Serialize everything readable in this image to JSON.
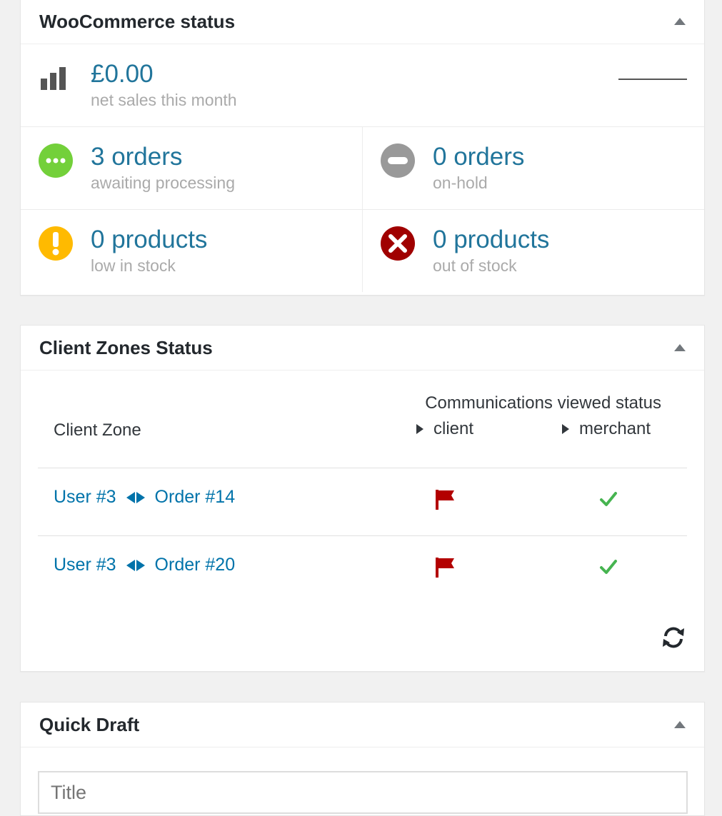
{
  "woo": {
    "title": "WooCommerce status",
    "net_sales_value": "£0.00",
    "net_sales_label": "net sales this month",
    "processing_value": "3 orders",
    "processing_label": "awaiting processing",
    "onhold_value": "0 orders",
    "onhold_label": "on-hold",
    "lowstock_value": "0 products",
    "lowstock_label": "low in stock",
    "outstock_value": "0 products",
    "outstock_label": "out of stock",
    "colors": {
      "link": "#21759b",
      "processing": "#73d03a",
      "onhold": "#999999",
      "lowstock": "#ffba00",
      "outstock": "#a00000"
    }
  },
  "zones": {
    "title": "Client Zones Status",
    "col_zone": "Client Zone",
    "col_comm": "Communications viewed status",
    "col_client": "client",
    "col_merchant": "merchant",
    "rows": [
      {
        "user": "User #3",
        "order": "Order #14",
        "client_status": "flag-icon",
        "merchant_status": "check-icon"
      },
      {
        "user": "User #3",
        "order": "Order #20",
        "client_status": "flag-icon",
        "merchant_status": "check-icon"
      }
    ],
    "colors": {
      "flag": "#b30000",
      "check": "#46b450"
    }
  },
  "draft": {
    "title": "Quick Draft",
    "title_placeholder": "Title"
  }
}
